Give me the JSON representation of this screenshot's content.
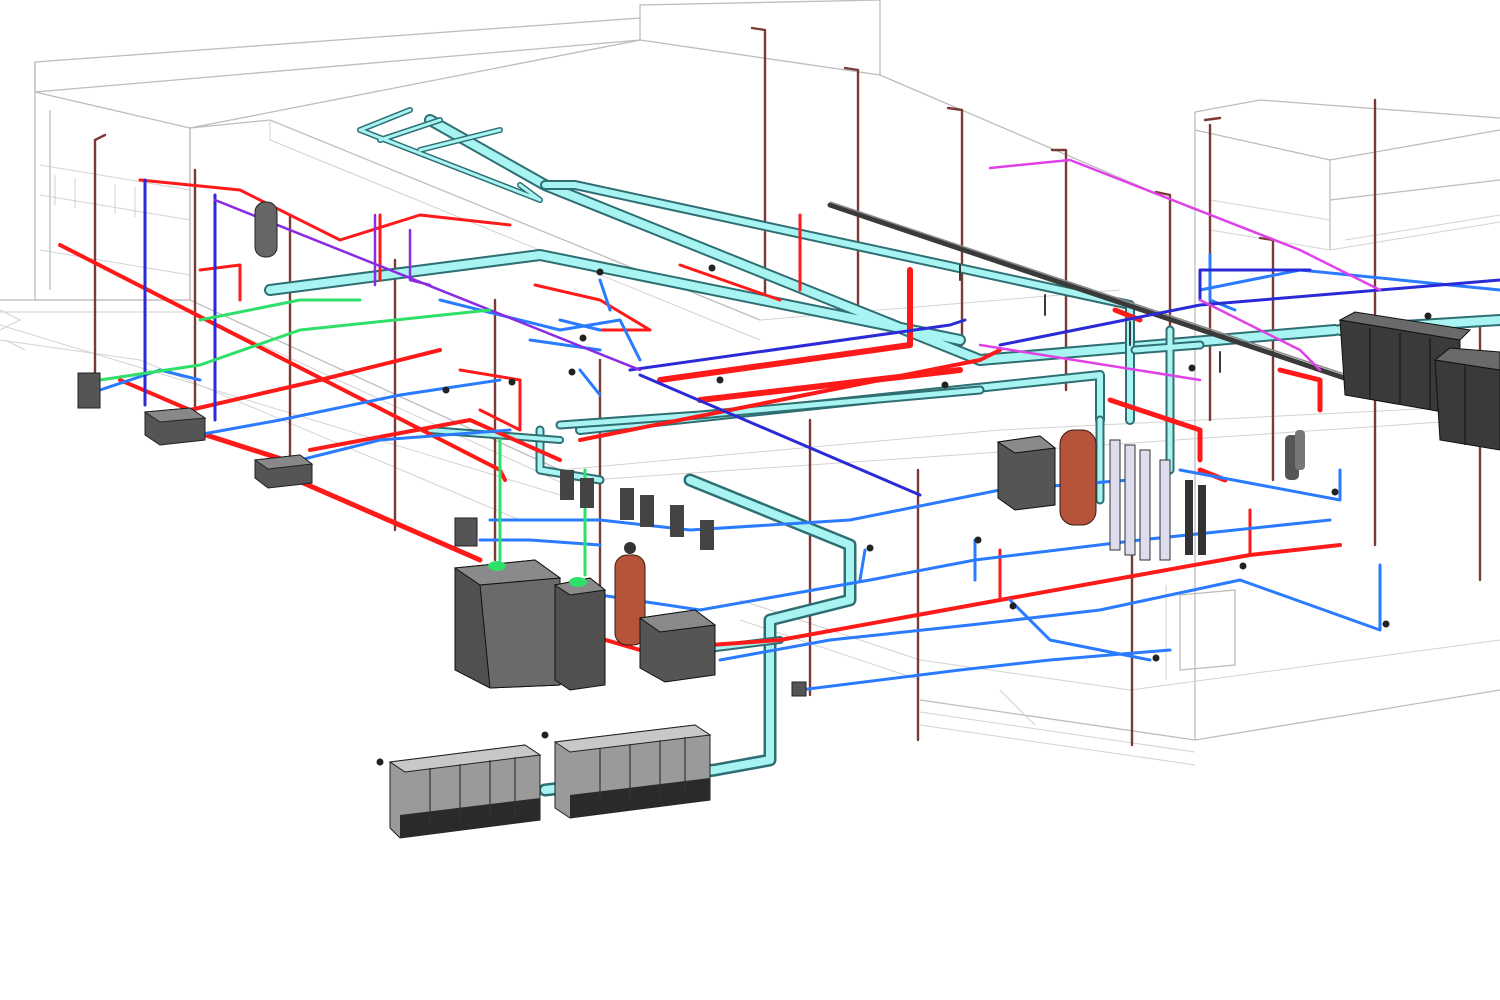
{
  "view": {
    "type": "3D isometric MEP piping model",
    "background": "#ffffff",
    "colors": {
      "building_outline": "#bdbdbd",
      "supply_hot": "#ff1a1a",
      "return_cold": "#2a7bff",
      "secondary": "#2a2ad6",
      "purple_line": "#8a2be2",
      "magenta_line": "#e040e8",
      "green_line": "#2ee06a",
      "main_header": "#a8f4f2",
      "vent_riser": "#7a3b36",
      "equipment": "#555555",
      "tank": "#b5543a"
    }
  }
}
